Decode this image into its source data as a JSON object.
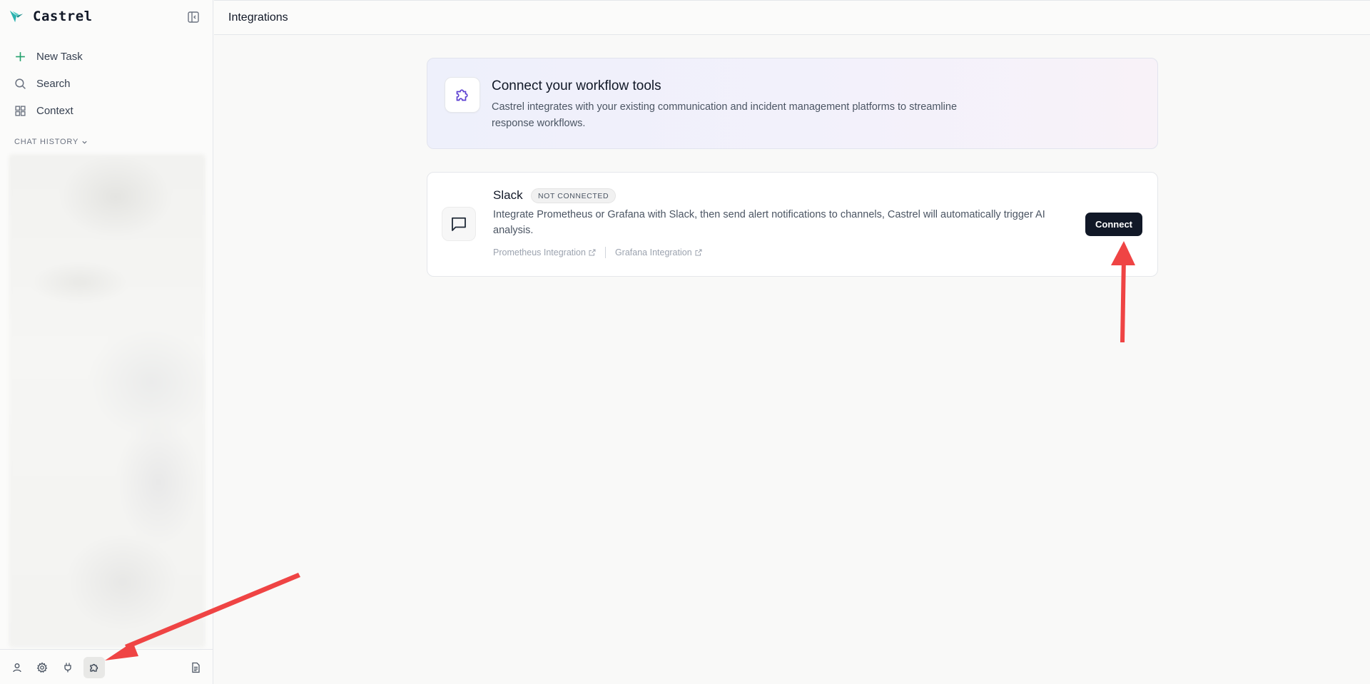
{
  "app": {
    "name": "Castrel",
    "brand_color": "#2bb3b0"
  },
  "sidebar": {
    "nav": [
      {
        "label": "New Task",
        "icon": "plus-icon"
      },
      {
        "label": "Search",
        "icon": "search-icon"
      },
      {
        "label": "Context",
        "icon": "grid-icon"
      }
    ],
    "history_label": "CHAT HISTORY",
    "footer": [
      {
        "icon": "user-icon"
      },
      {
        "icon": "gear-icon"
      },
      {
        "icon": "plug-icon"
      },
      {
        "icon": "puzzle-icon",
        "active": true
      },
      {
        "icon": "document-icon"
      }
    ]
  },
  "header": {
    "title": "Integrations"
  },
  "banner": {
    "title": "Connect your workflow tools",
    "description": "Castrel integrates with your existing communication and incident management platforms to streamline response workflows.",
    "icon": "puzzle-icon",
    "accent": "#5b3fd1"
  },
  "integrations": [
    {
      "name": "Slack",
      "status": "NOT CONNECTED",
      "description": "Integrate Prometheus or Grafana with Slack, then send alert notifications to channels, Castrel will automatically trigger AI analysis.",
      "links": [
        "Prometheus Integration",
        "Grafana Integration"
      ],
      "action": "Connect",
      "icon": "message-square-icon"
    }
  ],
  "annotations": {
    "arrow_color": "#ef4444"
  }
}
